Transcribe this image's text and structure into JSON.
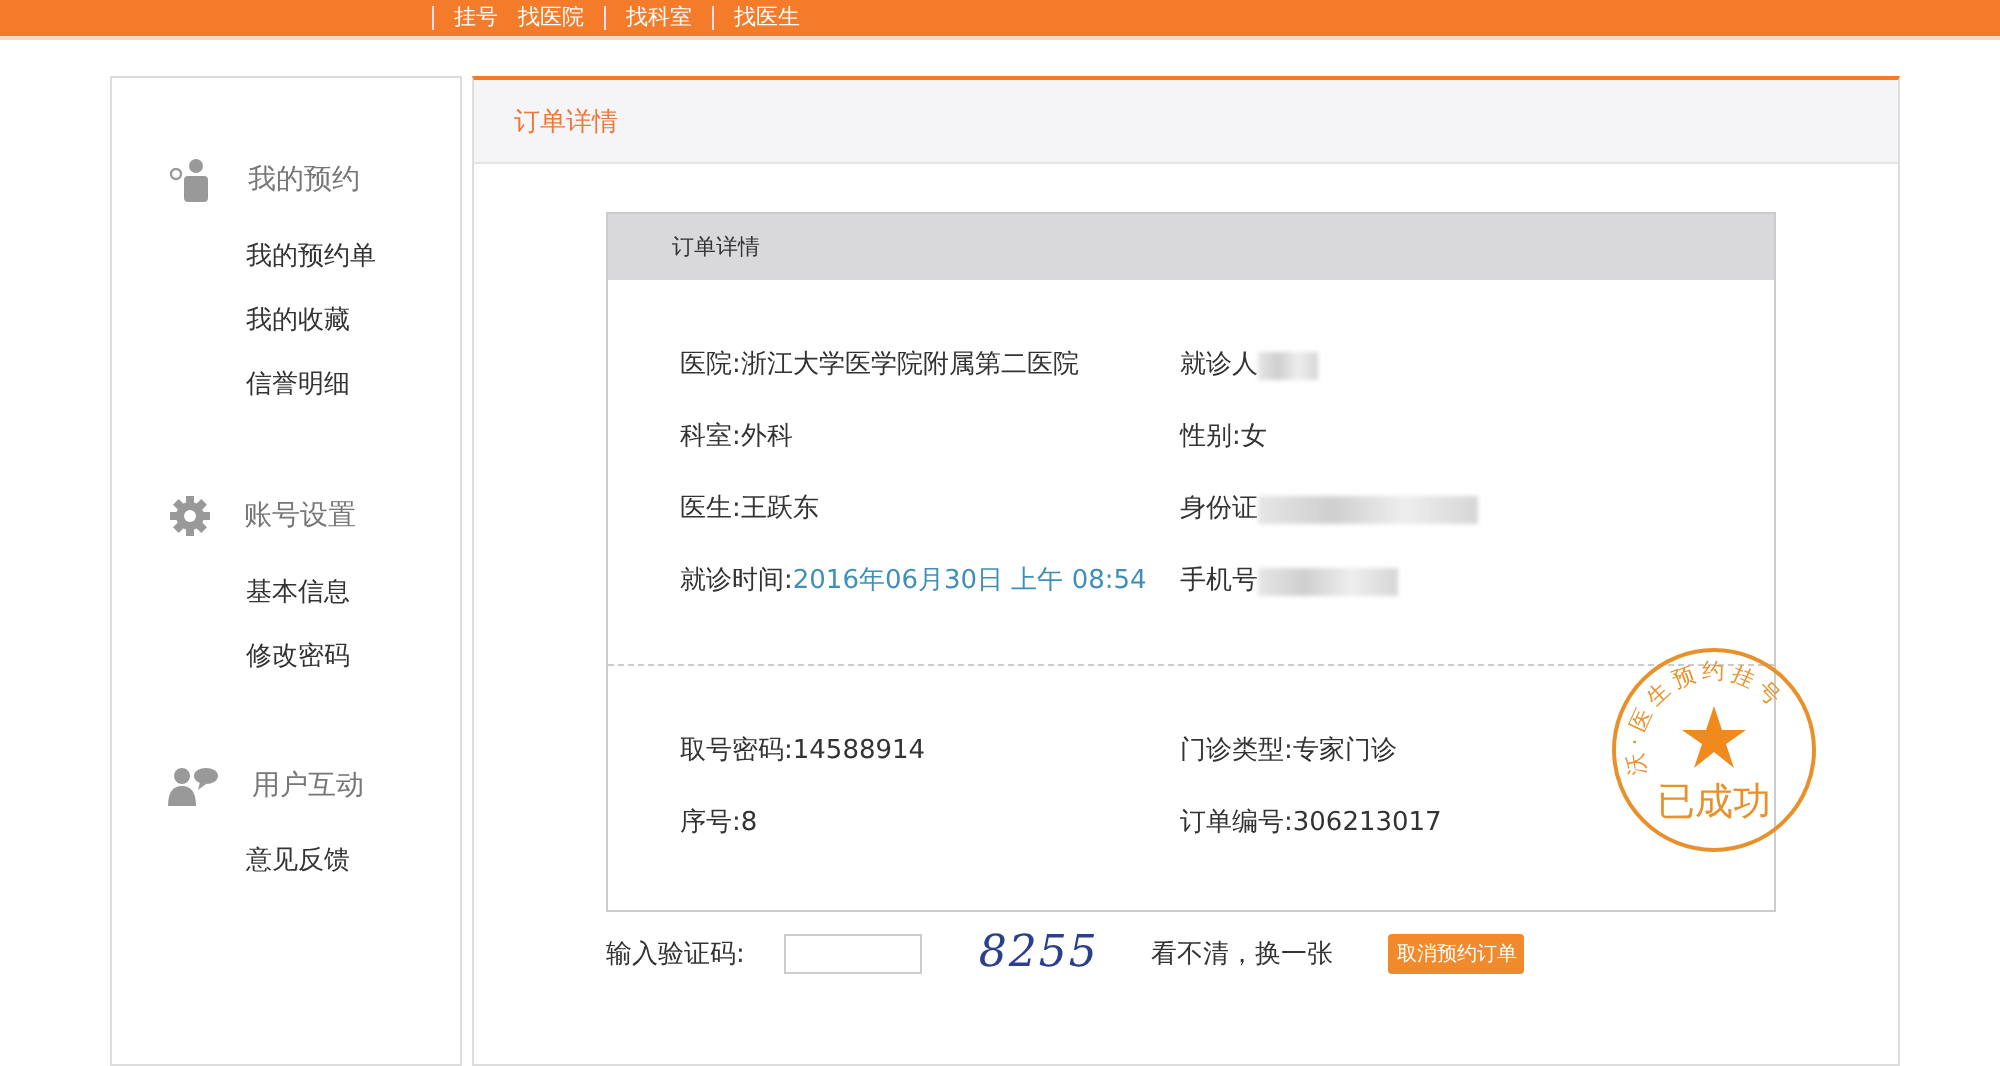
{
  "top_nav": {
    "items": [
      "挂号",
      "找医院",
      "找科室",
      "找医生"
    ]
  },
  "sidebar": {
    "groups": [
      {
        "kind": "appointment",
        "title": "我的预约",
        "items": [
          "我的预约单",
          "我的收藏",
          "信誉明细"
        ]
      },
      {
        "kind": "settings",
        "title": "账号设置",
        "items": [
          "基本信息",
          "修改密码"
        ]
      },
      {
        "kind": "interaction",
        "title": "用户互动",
        "items": [
          "意见反馈"
        ]
      }
    ]
  },
  "panel": {
    "title": "订单详情"
  },
  "order": {
    "title": "订单详情",
    "details": [
      {
        "label": "医院:",
        "value": "浙江大学医学院附属第二医院",
        "redacted": false
      },
      {
        "label": "就诊人",
        "redacted": true
      },
      {
        "label": "科室:",
        "value": "外科",
        "redacted": false
      },
      {
        "label": "性别:",
        "value": "女",
        "redacted": false
      },
      {
        "label": "医生:",
        "value": "王跃东",
        "redacted": false
      },
      {
        "label": "身份证",
        "redacted": true
      },
      {
        "label": "就诊时间:",
        "value": "2016年06月30日 上午 08:54",
        "redacted": false,
        "highlight": true
      },
      {
        "label": "手机号",
        "redacted": true
      }
    ],
    "codes": [
      {
        "label": "取号密码:",
        "value": "14588914"
      },
      {
        "label": "门诊类型:",
        "value": "专家门诊"
      },
      {
        "label": "序号:",
        "value": "8"
      },
      {
        "label": "订单编号:",
        "value": "306213017"
      }
    ],
    "stamp": {
      "ring": "沃·医生预约挂号",
      "status": "已成功"
    }
  },
  "captcha": {
    "label": "输入验证码:",
    "code": "8255",
    "refresh": "看不清，换一张",
    "cancel_button": "取消预约订单"
  }
}
